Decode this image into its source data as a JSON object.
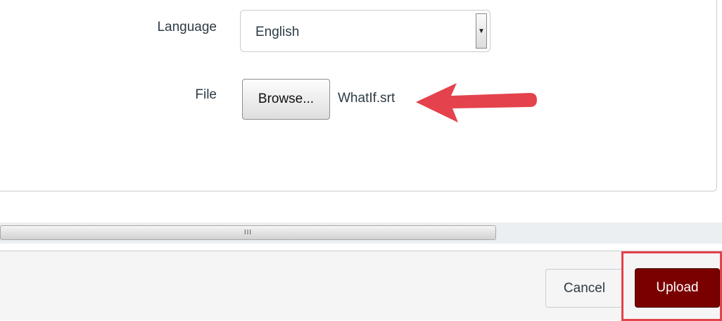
{
  "form": {
    "language_label": "Language",
    "language_value": "English",
    "file_label": "File",
    "browse_label": "Browse...",
    "file_name": "WhatIf.srt"
  },
  "scrollbar": {
    "grip": "III"
  },
  "footer": {
    "cancel_label": "Cancel",
    "upload_label": "Upload"
  },
  "colors": {
    "upload_bg": "#7a0000",
    "annotation_red": "#e4424c",
    "panel_border": "#c7cdd1"
  },
  "icons": [
    "dropdown-arrow-icon",
    "annotation-arrow-icon",
    "scroll-grip-icon"
  ]
}
